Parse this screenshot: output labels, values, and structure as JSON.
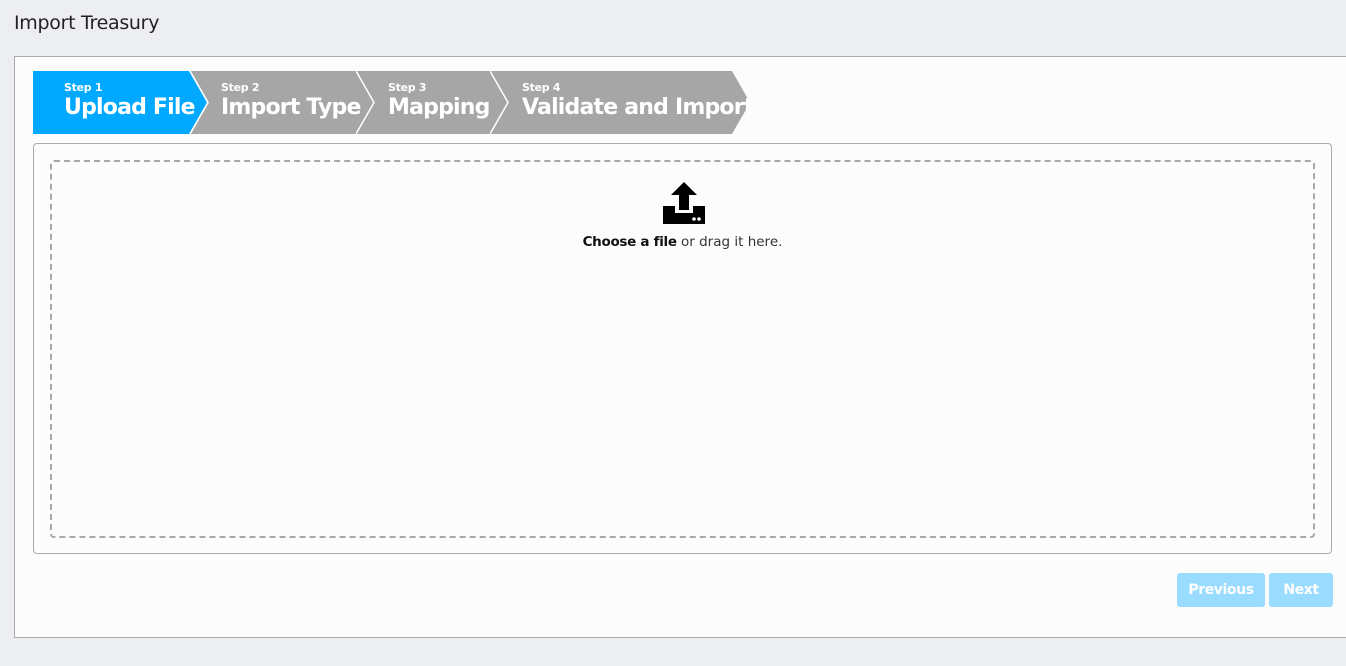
{
  "page": {
    "title": "Import Treasury"
  },
  "wizard": {
    "active_color": "#00a8ff",
    "inactive_color": "#a6a6a6",
    "steps": [
      {
        "number": "Step 1",
        "label": "Upload File",
        "active": true
      },
      {
        "number": "Step 2",
        "label": "Import Type",
        "active": false
      },
      {
        "number": "Step 3",
        "label": "Mapping",
        "active": false
      },
      {
        "number": "Step 4",
        "label": "Validate and Import",
        "active": false
      }
    ]
  },
  "dropzone": {
    "icon": "upload-icon",
    "choose_label": "Choose a file",
    "drag_text": " or drag it here."
  },
  "footer": {
    "previous_label": "Previous",
    "next_label": "Next",
    "buttons_disabled": true
  }
}
